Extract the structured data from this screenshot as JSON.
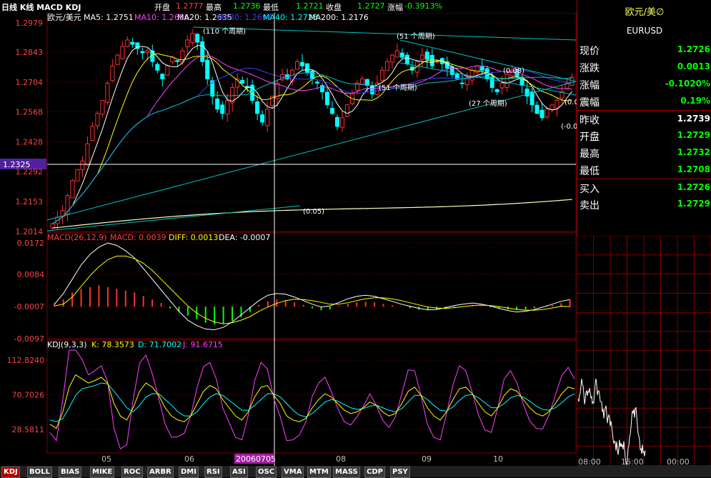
{
  "header": {
    "title": "日线 K线 MACD KDJ",
    "open_label": "开盘",
    "open_value": "1.2777",
    "high_label": "最高",
    "high_value": "1.2736",
    "low_label": "最低",
    "low_value": "1.2721",
    "close_label": "收盘",
    "close_value": "1.2727",
    "change_label": "涨幅",
    "change_value": "-0.3913%"
  },
  "ma_legend": {
    "symbol": "欧元/美元",
    "ma5": "MA5: 1.2751",
    "ma10": "MA10: 1.2656",
    "ma20": "MA20: 1.2635",
    "ma30": "MA30: 1.2697",
    "ma40": "MA40: 1.2728",
    "ma200": "MA200: 1.2176"
  },
  "macd_legend": {
    "name": "MACD(26,12,9)",
    "macd": "MACD: 0.0039",
    "diff": "DIFF: 0.0013",
    "dea": "DEA: -0.0007"
  },
  "kdj_legend": {
    "name": "KDJ(9,3,3)",
    "k": "K: 78.3573",
    "d": "D: 71.7002",
    "j": "J: 91.6715"
  },
  "price_axis": [
    "1.2979",
    "1.2843",
    "1.2704",
    "1.2568",
    "1.2428",
    "1.2292",
    "1.2153",
    "1.2014"
  ],
  "crosshair_price": "1.2325",
  "macd_axis": [
    "0.0172",
    "0.0084",
    "-0.0007",
    "-0.0097"
  ],
  "kdj_axis": [
    "112.8240",
    "70.7026",
    "28.5811"
  ],
  "month_labels": [
    "05",
    "06",
    "08",
    "09",
    "10"
  ],
  "crosshair_date": "20060705",
  "annotations": [
    "(110 个周期)",
    "(51 个周期)",
    "(51 个周期)",
    "(27 个周期)",
    "(0.08)",
    "(0.05)",
    "(0.0",
    "(-0.0"
  ],
  "quote": {
    "title": "欧元/美∅",
    "symbol": "EURUSD",
    "rows": [
      {
        "k": "现价",
        "v": "1.2726",
        "c": "#00ff00"
      },
      {
        "k": "涨跌",
        "v": "0.0013",
        "c": "#00ff00"
      },
      {
        "k": "涨幅",
        "v": "-0.1020%",
        "c": "#00ff00"
      },
      {
        "k": "震幅",
        "v": "0.19%",
        "c": "#00ff00"
      },
      {
        "k": "昨收",
        "v": "1.2739",
        "c": "#ffffff"
      },
      {
        "k": "开盘",
        "v": "1.2729",
        "c": "#00ff00"
      },
      {
        "k": "最高",
        "v": "1.2732",
        "c": "#00ff00"
      },
      {
        "k": "最低",
        "v": "1.2708",
        "c": "#00ff00"
      },
      {
        "k": "买入",
        "v": "1.2726",
        "c": "#00ff00"
      },
      {
        "k": "卖出",
        "v": "1.2729",
        "c": "#00ff00"
      }
    ]
  },
  "mini_time_labels": [
    "08:00",
    "16:00",
    "00:00"
  ],
  "tabs": [
    "KDJ",
    "BOLL",
    "BIAS",
    "MIKE",
    "ROC",
    "ARBR",
    "DMI",
    "RSI",
    "ASI",
    "OSC",
    "VMA",
    "MTM",
    "MASS",
    "CDP",
    "PSY"
  ],
  "colors": {
    "up": "#ff3030",
    "down": "#00ffff",
    "grid": "#800000",
    "ma5": "#ffffff",
    "ma10": "#ffff00",
    "ma20": "#ff40ff",
    "ma30": "#4040ff",
    "ma40": "#00c0c0",
    "ma200": "#ffffc0"
  },
  "chart_data": {
    "type": "candlestick",
    "title": "EURUSD 日线",
    "ylim": [
      1.2014,
      1.2979
    ],
    "month_ticks": [
      "05",
      "06",
      "08",
      "09",
      "10"
    ],
    "closes": [
      1.205,
      1.208,
      1.211,
      1.218,
      1.225,
      1.23,
      1.234,
      1.242,
      1.25,
      1.256,
      1.262,
      1.27,
      1.278,
      1.283,
      1.287,
      1.29,
      1.288,
      1.286,
      1.284,
      1.285,
      1.28,
      1.276,
      1.272,
      1.278,
      1.282,
      1.28,
      1.285,
      1.29,
      1.293,
      1.289,
      1.28,
      1.272,
      1.264,
      1.258,
      1.256,
      1.262,
      1.268,
      1.272,
      1.27,
      1.268,
      1.262,
      1.256,
      1.252,
      1.258,
      1.264,
      1.27,
      1.274,
      1.272,
      1.276,
      1.28,
      1.278,
      1.275,
      1.272,
      1.27,
      1.266,
      1.26,
      1.256,
      1.25,
      1.254,
      1.26,
      1.265,
      1.27,
      1.272,
      1.269,
      1.265,
      1.27,
      1.276,
      1.28,
      1.283,
      1.285,
      1.282,
      1.279,
      1.276,
      1.28,
      1.283,
      1.281,
      1.278,
      1.28,
      1.279,
      1.277,
      1.274,
      1.272,
      1.27,
      1.272,
      1.276,
      1.278,
      1.276,
      1.272,
      1.268,
      1.266,
      1.27,
      1.274,
      1.276,
      1.273,
      1.269,
      1.264,
      1.26,
      1.256,
      1.254,
      1.258,
      1.26,
      1.262,
      1.266,
      1.27,
      1.2727
    ],
    "kdj": {
      "k": [
        35,
        30,
        50,
        80,
        95,
        90,
        85,
        88,
        92,
        85,
        60,
        45,
        40,
        55,
        75,
        85,
        80,
        70,
        55,
        45,
        40,
        38,
        45,
        60,
        75,
        82,
        78,
        65,
        55,
        45,
        40,
        50,
        68,
        80,
        82,
        70,
        60,
        45,
        40,
        38,
        42,
        55,
        65,
        72,
        68,
        60,
        52,
        48,
        50,
        55,
        62,
        58,
        50,
        45,
        48,
        60,
        75,
        80,
        70,
        55,
        45,
        40,
        50,
        65,
        78,
        80,
        72,
        60,
        50,
        45,
        55,
        70,
        78,
        75,
        65,
        55,
        48,
        45,
        50,
        60,
        72,
        80,
        78
      ],
      "d": [
        40,
        38,
        42,
        55,
        70,
        78,
        80,
        82,
        85,
        84,
        75,
        65,
        55,
        50,
        58,
        68,
        72,
        72,
        65,
        58,
        50,
        45,
        45,
        50,
        60,
        68,
        72,
        70,
        64,
        58,
        52,
        52,
        58,
        65,
        72,
        72,
        68,
        60,
        52,
        46,
        44,
        48,
        55,
        62,
        65,
        63,
        59,
        55,
        53,
        54,
        57,
        58,
        55,
        52,
        50,
        54,
        62,
        70,
        70,
        65,
        58,
        52,
        51,
        56,
        64,
        70,
        71,
        67,
        61,
        55,
        55,
        60,
        67,
        70,
        68,
        63,
        57,
        53,
        52,
        55,
        61,
        68,
        72
      ],
      "j": [
        25,
        15,
        65,
        130,
        145,
        114,
        95,
        100,
        106,
        87,
        30,
        5,
        10,
        65,
        109,
        119,
        96,
        66,
        35,
        19,
        20,
        24,
        45,
        80,
        105,
        110,
        90,
        55,
        37,
        19,
        16,
        46,
        88,
        110,
        102,
        66,
        44,
        15,
        16,
        22,
        38,
        69,
        85,
        92,
        74,
        54,
        38,
        34,
        44,
        57,
        72,
        58,
        40,
        31,
        44,
        72,
        101,
        100,
        70,
        35,
        19,
        16,
        48,
        83,
        106,
        100,
        74,
        46,
        28,
        25,
        55,
        90,
        100,
        85,
        59,
        39,
        30,
        29,
        46,
        70,
        94,
        104,
        90
      ]
    },
    "macd": {
      "hist": [
        0.001,
        0.002,
        0.004,
        0.005,
        0.0055,
        0.006,
        0.0055,
        0.005,
        0.0045,
        0.004,
        0.003,
        0.002,
        0.001,
        -0.0005,
        -0.0015,
        -0.0025,
        -0.0035,
        -0.0045,
        -0.005,
        -0.0048,
        -0.004,
        -0.003,
        -0.0015,
        0.0005,
        0.0015,
        0.002,
        0.0018,
        0.0012,
        0.0005,
        -0.0005,
        -0.001,
        -0.0008,
        0.0002,
        0.0008,
        0.0012,
        0.0014,
        0.0012,
        0.0008,
        0.0004,
        0.0,
        -0.0004,
        -0.0008,
        -0.001,
        -0.0009,
        -0.0006,
        -0.0003,
        0.0,
        0.0002,
        0.0001,
        -0.0002,
        -0.0005,
        -0.0008,
        -0.001,
        -0.0008,
        -0.0004,
        0.0,
        0.0004,
        0.001,
        0.0018
      ],
      "diff": [
        0.0,
        0.003,
        0.007,
        0.011,
        0.014,
        0.016,
        0.0172,
        0.0165,
        0.015,
        0.013,
        0.01,
        0.007,
        0.004,
        0.001,
        -0.002,
        -0.0045,
        -0.006,
        -0.007,
        -0.0072,
        -0.0065,
        -0.005,
        -0.003,
        -0.001,
        0.001,
        0.0025,
        0.003,
        0.0028,
        0.002,
        0.001,
        0.0,
        -0.0008,
        -0.0005,
        0.0005,
        0.0015,
        0.0022,
        0.0025,
        0.0022,
        0.0015,
        0.0008,
        0.0,
        -0.0006,
        -0.0012,
        -0.0016,
        -0.0015,
        -0.001,
        -0.0004,
        0.0,
        0.0003,
        0.0,
        -0.0005,
        -0.0012,
        -0.0018,
        -0.0022,
        -0.002,
        -0.0015,
        -0.0008,
        0.0,
        0.0008,
        0.0013
      ],
      "dea": [
        -0.0005,
        0.0,
        0.002,
        0.005,
        0.008,
        0.0105,
        0.0125,
        0.0135,
        0.0135,
        0.0128,
        0.0115,
        0.0095,
        0.007,
        0.0045,
        0.002,
        -0.0005,
        -0.0025,
        -0.004,
        -0.005,
        -0.0055,
        -0.0052,
        -0.0045,
        -0.0035,
        -0.002,
        -0.0008,
        0.0002,
        0.001,
        0.0014,
        0.0013,
        0.001,
        0.0005,
        0.0,
        0.0,
        0.0004,
        0.001,
        0.0015,
        0.0018,
        0.0018,
        0.0015,
        0.001,
        0.0004,
        -0.0002,
        -0.0008,
        -0.0011,
        -0.0012,
        -0.001,
        -0.0007,
        -0.0004,
        -0.0003,
        -0.0004,
        -0.0007,
        -0.0011,
        -0.0015,
        -0.0017,
        -0.0017,
        -0.0015,
        -0.0011,
        -0.0006,
        -0.0007
      ]
    }
  }
}
